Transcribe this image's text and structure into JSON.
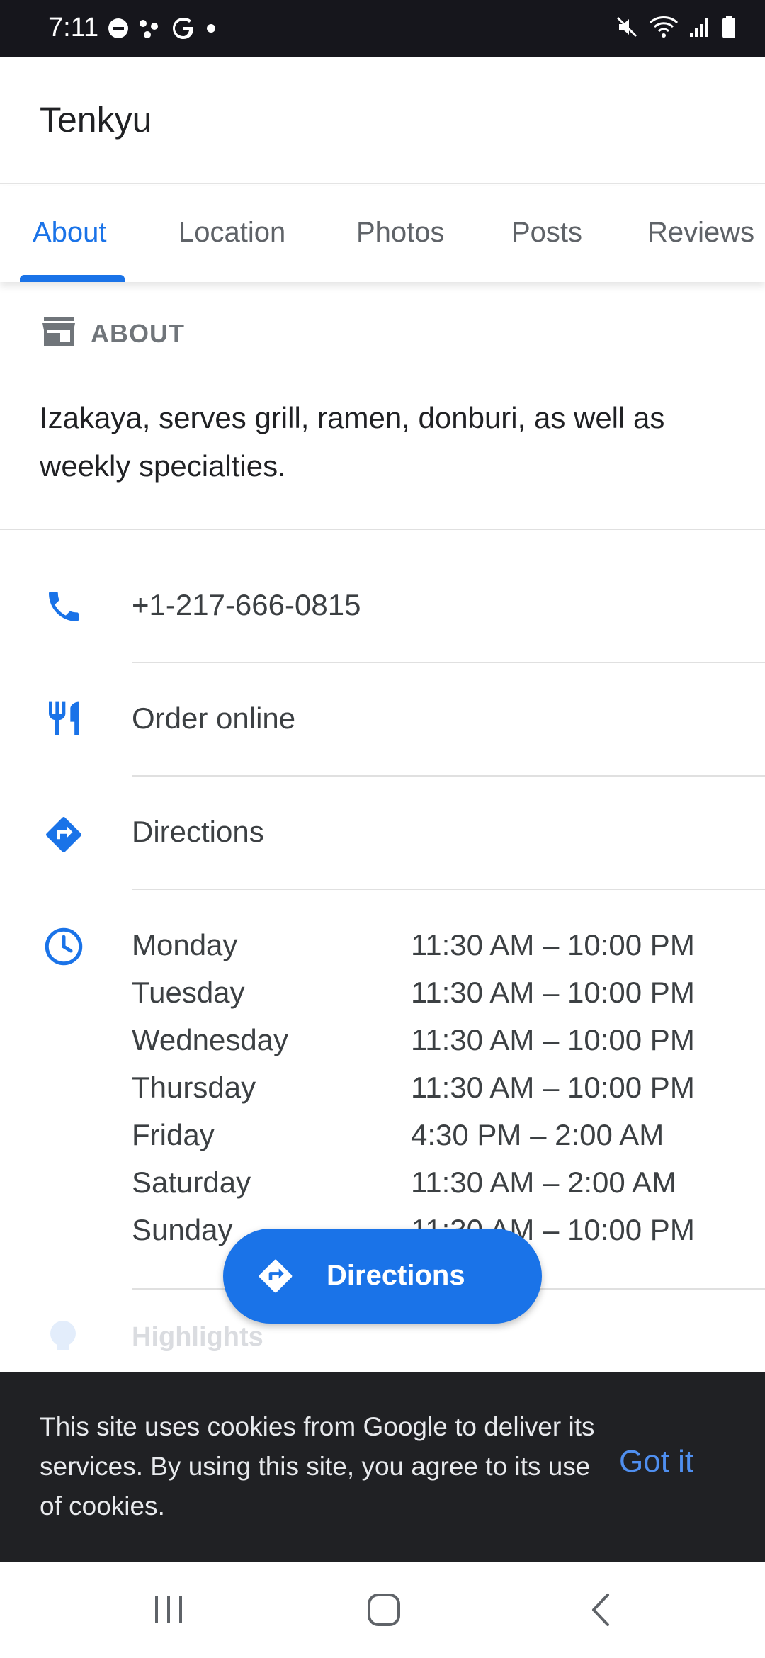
{
  "status_bar": {
    "time": "7:11",
    "left_icons": [
      "do-not-disturb-icon",
      "dots-icon",
      "google-icon",
      "dot-icon"
    ],
    "right_icons": [
      "mute-icon",
      "wifi-icon",
      "signal-icon",
      "battery-icon"
    ]
  },
  "header": {
    "title": "Tenkyu"
  },
  "tabs": [
    {
      "label": "About",
      "active": true
    },
    {
      "label": "Location",
      "active": false
    },
    {
      "label": "Photos",
      "active": false
    },
    {
      "label": "Posts",
      "active": false
    },
    {
      "label": "Reviews",
      "active": false
    }
  ],
  "about": {
    "heading": "ABOUT",
    "description": "Izakaya, serves grill, ramen, donburi, as well as weekly specialties."
  },
  "contact": {
    "phone": "+1-217-666-0815",
    "order": "Order online",
    "directions": "Directions"
  },
  "hours": [
    {
      "day": "Monday",
      "time": "11:30 AM – 10:00 PM"
    },
    {
      "day": "Tuesday",
      "time": "11:30 AM – 10:00 PM"
    },
    {
      "day": "Wednesday",
      "time": "11:30 AM – 10:00 PM"
    },
    {
      "day": "Thursday",
      "time": "11:30 AM – 10:00 PM"
    },
    {
      "day": "Friday",
      "time": "4:30 PM – 2:00 AM"
    },
    {
      "day": "Saturday",
      "time": "11:30 AM – 2:00 AM"
    },
    {
      "day": "Sunday",
      "time": "11:30 AM – 10:00 PM"
    }
  ],
  "highlights_label": "Highlights",
  "fab": {
    "label": "Directions"
  },
  "cookie": {
    "text": "This site uses cookies from Google to deliver its services. By using this site, you agree to its use of cookies.",
    "button": "Got it"
  },
  "colors": {
    "accent": "#1a73e8",
    "status_bar": "#16161c",
    "cookie_bg": "#202124",
    "cookie_button": "#4f8ff0"
  }
}
